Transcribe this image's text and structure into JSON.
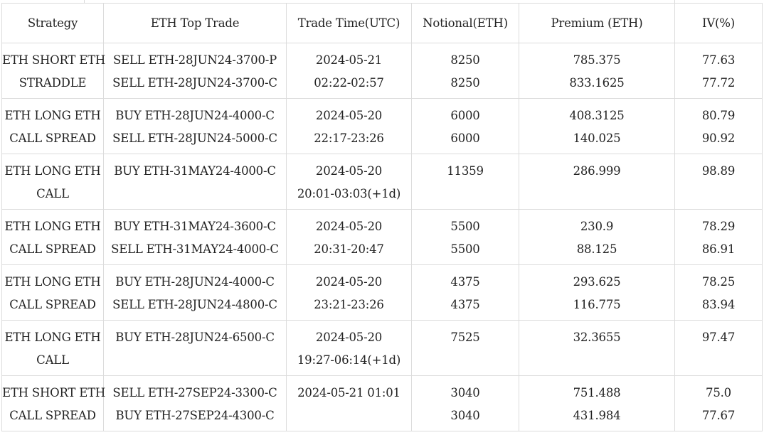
{
  "table": {
    "headers": [
      "Strategy",
      "ETH Top Trade",
      "Trade Time(UTC)",
      "Notional(ETH)",
      "Premium (ETH)",
      "IV(%)"
    ],
    "rows": [
      {
        "strategy": [
          "ETH SHORT ETH",
          "STRADDLE"
        ],
        "trades": [
          "SELL ETH-28JUN24-3700-P",
          "SELL ETH-28JUN24-3700-C"
        ],
        "time": [
          "2024-05-21",
          "02:22-02:57"
        ],
        "notional": [
          "8250",
          "8250"
        ],
        "premium": [
          "785.375",
          "833.1625"
        ],
        "iv": [
          "77.63",
          "77.72"
        ]
      },
      {
        "strategy": [
          "ETH LONG ETH",
          "CALL SPREAD"
        ],
        "trades": [
          "BUY ETH-28JUN24-4000-C",
          "SELL ETH-28JUN24-5000-C"
        ],
        "time": [
          "2024-05-20",
          "22:17-23:26"
        ],
        "notional": [
          "6000",
          "6000"
        ],
        "premium": [
          "408.3125",
          "140.025"
        ],
        "iv": [
          "80.79",
          "90.92"
        ]
      },
      {
        "strategy": [
          "ETH LONG ETH",
          "CALL"
        ],
        "trades": [
          "BUY ETH-31MAY24-4000-C",
          ""
        ],
        "time": [
          "2024-05-20",
          "20:01-03:03(+1d)"
        ],
        "notional": [
          "11359",
          ""
        ],
        "premium": [
          "286.999",
          ""
        ],
        "iv": [
          "98.89",
          ""
        ]
      },
      {
        "strategy": [
          "ETH LONG ETH",
          "CALL SPREAD"
        ],
        "trades": [
          "BUY ETH-31MAY24-3600-C",
          "SELL ETH-31MAY24-4000-C"
        ],
        "time": [
          "2024-05-20",
          "20:31-20:47"
        ],
        "notional": [
          "5500",
          "5500"
        ],
        "premium": [
          "230.9",
          "88.125"
        ],
        "iv": [
          "78.29",
          "86.91"
        ]
      },
      {
        "strategy": [
          "ETH LONG ETH",
          "CALL SPREAD"
        ],
        "trades": [
          "BUY ETH-28JUN24-4000-C",
          "SELL ETH-28JUN24-4800-C"
        ],
        "time": [
          "2024-05-20",
          "23:21-23:26"
        ],
        "notional": [
          "4375",
          "4375"
        ],
        "premium": [
          "293.625",
          "116.775"
        ],
        "iv": [
          "78.25",
          "83.94"
        ]
      },
      {
        "strategy": [
          "ETH LONG ETH",
          "CALL"
        ],
        "trades": [
          "BUY ETH-28JUN24-6500-C",
          ""
        ],
        "time": [
          "2024-05-20",
          "19:27-06:14(+1d)"
        ],
        "notional": [
          "7525",
          ""
        ],
        "premium": [
          "32.3655",
          ""
        ],
        "iv": [
          "97.47",
          ""
        ]
      },
      {
        "strategy": [
          "ETH SHORT ETH",
          "CALL SPREAD"
        ],
        "trades": [
          "SELL ETH-27SEP24-3300-C",
          "BUY ETH-27SEP24-4300-C"
        ],
        "time": [
          "2024-05-21 01:01",
          ""
        ],
        "notional": [
          "3040",
          "3040"
        ],
        "premium": [
          "751.488",
          "431.984"
        ],
        "iv": [
          "75.0",
          "77.67"
        ]
      }
    ]
  }
}
